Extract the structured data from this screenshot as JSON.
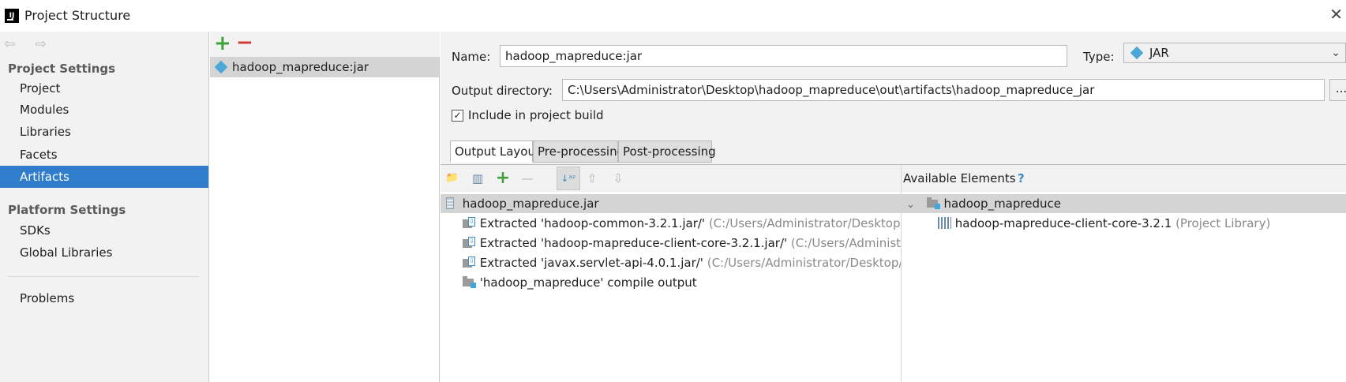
{
  "window": {
    "title": "Project Structure",
    "logo_text": "IJ",
    "close_glyph": "✕"
  },
  "nav": {
    "back_forward": "⇦ ⇨",
    "project_settings_header": "Project Settings",
    "items_project": [
      "Project",
      "Modules",
      "Libraries",
      "Facets",
      "Artifacts"
    ],
    "platform_settings_header": "Platform Settings",
    "items_platform": [
      "SDKs",
      "Global Libraries"
    ],
    "problems": "Problems",
    "selected": "Artifacts"
  },
  "artifacts": {
    "add_glyph": "+",
    "remove_glyph": "−",
    "list": [
      "hadoop_mapreduce:jar"
    ]
  },
  "form": {
    "name_label": "Name:",
    "name_value": "hadoop_mapreduce:jar",
    "type_label": "Type:",
    "type_value": "JAR",
    "output_dir_label": "Output directory:",
    "output_dir_value": "C:\\Users\\Administrator\\Desktop\\hadoop_mapreduce\\out\\artifacts\\hadoop_mapreduce_jar",
    "browse_label": "...",
    "include_label": "Include in project build",
    "include_checked": true,
    "check_glyph": "✓"
  },
  "tabs": [
    "Output Layout",
    "Pre-processing",
    "Post-processing"
  ],
  "active_tab": "Output Layout",
  "layout_toolbar": {
    "new_dir_glyph": "📁",
    "archive_glyph": "▥",
    "add_glyph": "+",
    "remove_glyph": "—",
    "sort_glyph": "↓ᵃᶻ",
    "up_glyph": "⇧",
    "down_glyph": "⇩"
  },
  "output_tree": {
    "root": "hadoop_mapreduce.jar",
    "children": [
      {
        "label": "Extracted 'hadoop-common-3.2.1.jar/'",
        "hint": "(C:/Users/Administrator/Desktop/h"
      },
      {
        "label": "Extracted 'hadoop-mapreduce-client-core-3.2.1.jar/'",
        "hint": "(C:/Users/Administra"
      },
      {
        "label": "Extracted 'javax.servlet-api-4.0.1.jar/'",
        "hint": "(C:/Users/Administrator/Desktop/ha"
      },
      {
        "label": "'hadoop_mapreduce' compile output",
        "hint": ""
      }
    ],
    "extract_glyph": "⇩"
  },
  "available": {
    "title": "Available Elements",
    "help": "?",
    "module": "hadoop_mapreduce",
    "expander": "⌄",
    "library": "hadoop-mapreduce-client-core-3.2.1",
    "library_hint": "(Project Library)"
  },
  "colors": {
    "selection": "#2f7dcb",
    "add": "#3fa23a",
    "remove": "#d33b3b",
    "accent": "#3c8dc5"
  }
}
